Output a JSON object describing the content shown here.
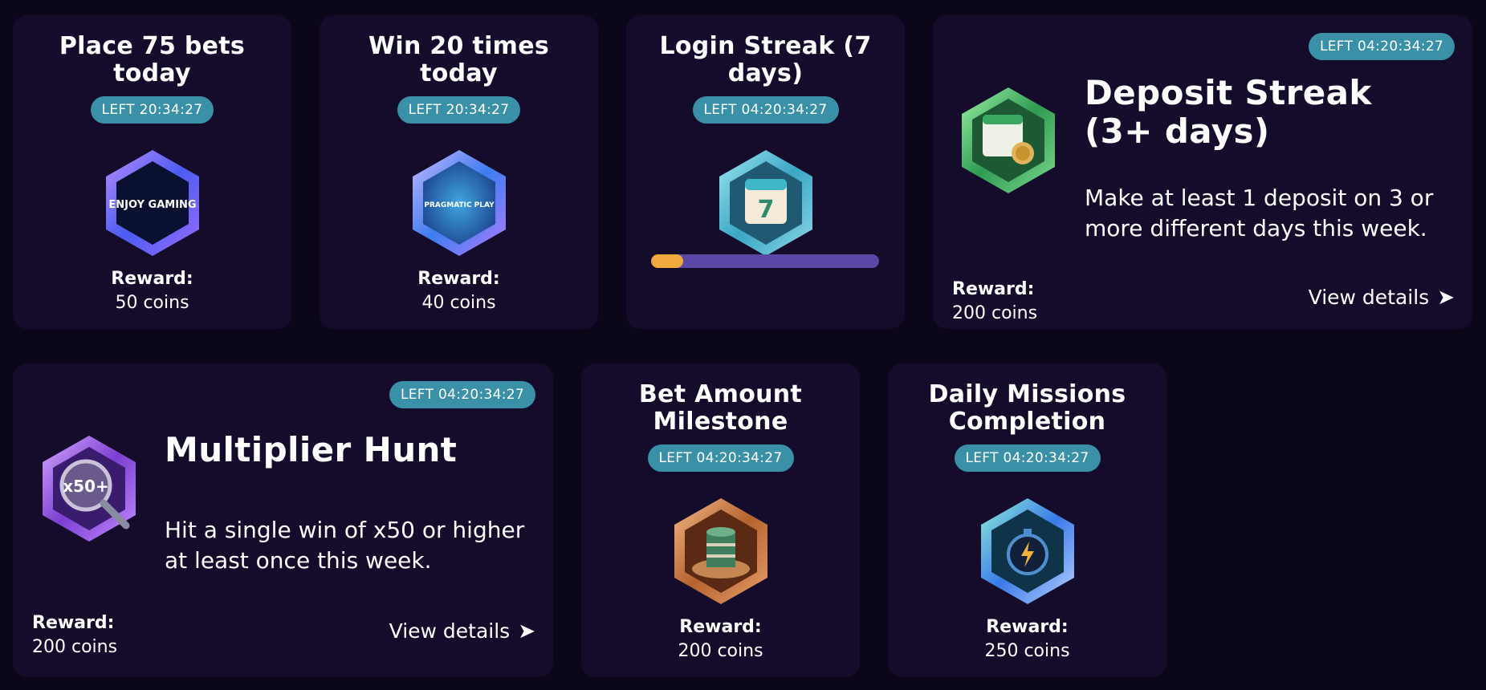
{
  "missions": [
    {
      "title": "Place 75 bets today",
      "timer": "LEFT 20:34:27",
      "reward_label": "Reward:",
      "reward_value": "50 coins",
      "icon": "enjoy-gaming-icon",
      "icon_text": "ENJOY GAMING"
    },
    {
      "title": "Win 20 times today",
      "timer": "LEFT 20:34:27",
      "reward_label": "Reward:",
      "reward_value": "40 coins",
      "icon": "pragmatic-play-icon",
      "icon_text": "PRAGMATIC PLAY"
    },
    {
      "title": "Login Streak (7 days)",
      "timer": "LEFT 04:20:34:27",
      "icon": "calendar-7-icon",
      "icon_text": "7",
      "progress": 0.14
    },
    {
      "title": "Deposit Streak (3+ days)",
      "timer": "LEFT 04:20:34:27",
      "description": "Make at least 1 deposit on 3 or more different days this week.",
      "reward_label": "Reward:",
      "reward_value": "200 coins",
      "view_details": "View details",
      "icon": "calendar-coins-icon"
    },
    {
      "title": "Multiplier Hunt",
      "timer": "LEFT 04:20:34:27",
      "description": "Hit a single win of x50 or higher at least once this week.",
      "reward_label": "Reward:",
      "reward_value": "200 coins",
      "view_details": "View details",
      "icon": "magnifier-x50-icon",
      "icon_text": "x50+"
    },
    {
      "title": "Bet Amount Milestone",
      "timer": "LEFT 04:20:34:27",
      "reward_label": "Reward:",
      "reward_value": "200 coins",
      "icon": "roulette-chips-icon"
    },
    {
      "title": "Daily Missions Completion",
      "timer": "LEFT 04:20:34:27",
      "reward_label": "Reward:",
      "reward_value": "250 coins",
      "icon": "stopwatch-icon"
    }
  ],
  "colors": {
    "background": "#0b0619",
    "card": "#150c2c",
    "timer_badge": "#3a90a6",
    "progress_track": "#5b47a6",
    "progress_fill": "#f0a93d"
  }
}
